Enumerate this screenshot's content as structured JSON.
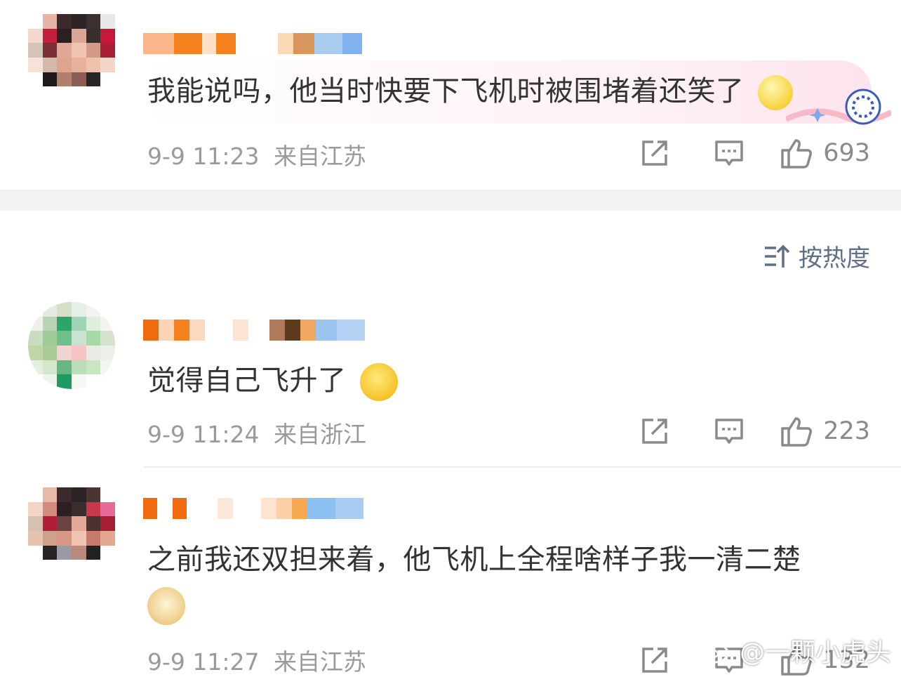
{
  "comments": [
    {
      "text": "我能说吗，他当时快要下飞机时被围堵着还笑了",
      "time": "9-9 11:23",
      "location": "来自江苏",
      "likes": "693"
    },
    {
      "text": "觉得自己飞升了",
      "time": "9-9 11:24",
      "location": "来自浙江",
      "likes": "223"
    },
    {
      "text": "之前我还双担来着，他飞机上全程啥样子我一清二楚",
      "time": "9-9 11:27",
      "location": "来自江苏",
      "likes": "132"
    }
  ],
  "sort": {
    "label": "按热度"
  },
  "watermark": {
    "text": "@一颗小虎头"
  },
  "colors": {
    "meta_gray": "#9a9a9a",
    "sort_blue": "#5f6f86",
    "divider": "#f2f2f2"
  }
}
